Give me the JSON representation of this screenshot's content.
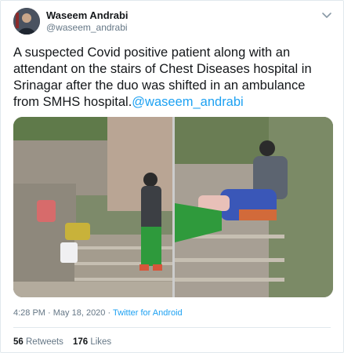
{
  "tweet": {
    "author_name": "Waseem Andrabi",
    "author_handle": "@waseem_andrabi",
    "text": "A suspected Covid positive patient along with an attendant on the stairs of Chest Diseases hospital in Srinagar after the duo was shifted in an ambulance from SMHS hospital.",
    "mention": "@waseem_andrabi",
    "time": "4:28 PM",
    "separator": "·",
    "date": "May 18, 2020",
    "source": "Twitter for Android",
    "retweets_count": "56",
    "retweets_label": "Retweets",
    "likes_count": "176",
    "likes_label": "Likes"
  },
  "icons": {
    "menu": "chevron-down-icon",
    "avatar": "avatar"
  },
  "colors": {
    "link": "#1da1f2",
    "secondary_text": "#657786",
    "primary_text": "#14171a",
    "border": "#e1e8ed"
  }
}
